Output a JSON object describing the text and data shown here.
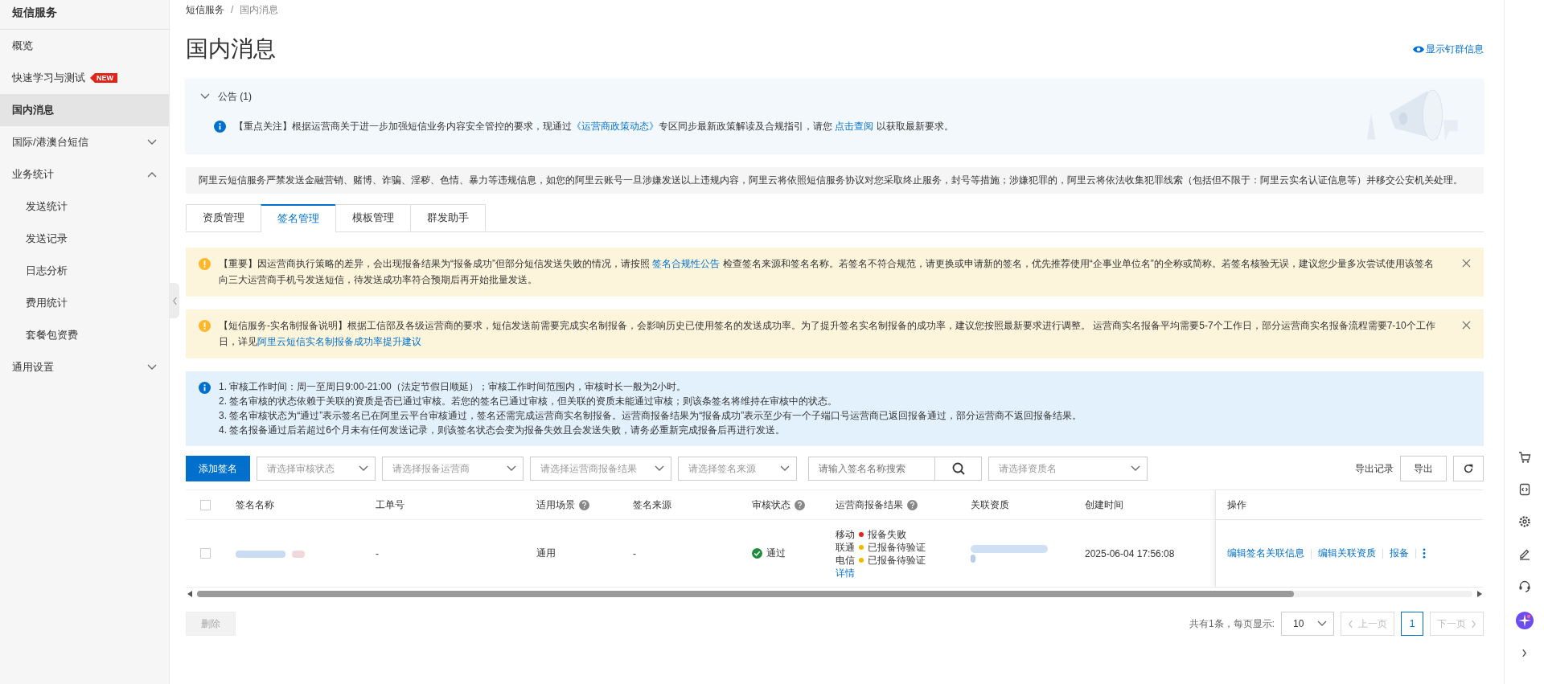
{
  "sidebar": {
    "title": "短信服务",
    "items": [
      {
        "kind": "link",
        "label": "概览",
        "selected": false
      },
      {
        "kind": "link",
        "label": "快速学习与测试",
        "badge": "NEW",
        "selected": false
      },
      {
        "kind": "link",
        "label": "国内消息",
        "selected": true
      },
      {
        "kind": "group",
        "label": "国际/港澳台短信",
        "expanded": false,
        "selected": false
      },
      {
        "kind": "group",
        "label": "业务统计",
        "expanded": true,
        "selected": false,
        "children": [
          {
            "label": "发送统计",
            "selected": false
          },
          {
            "label": "发送记录",
            "selected": false
          },
          {
            "label": "日志分析",
            "selected": false
          },
          {
            "label": "费用统计",
            "selected": false
          },
          {
            "label": "套餐包资费",
            "selected": false
          }
        ]
      },
      {
        "kind": "group",
        "label": "通用设置",
        "expanded": false,
        "selected": false
      }
    ]
  },
  "breadcrumb": {
    "separator": "/",
    "items": [
      "短信服务",
      "国内消息"
    ]
  },
  "page_title": "国内消息",
  "group_info_link": "显示钉群信息",
  "announcement": {
    "title": "公告 (1)",
    "expanded": true,
    "segments": [
      {
        "text": "【重点关注】根据运营商关于进一步加强短信业务内容安全管控的要求，现通过",
        "kind": "text"
      },
      {
        "text": "《运营商政策动态》",
        "kind": "link"
      },
      {
        "text": "专区同步最新政策解读及合规指引，请您 ",
        "kind": "text"
      },
      {
        "text": "点击查阅",
        "kind": "link"
      },
      {
        "text": " 以获取最新要求。",
        "kind": "text"
      }
    ]
  },
  "compliance_notice": "阿里云短信服务严禁发送金融营销、赌博、诈骗、淫秽、色情、暴力等违规信息，如您的阿里云账号一旦涉嫌发送以上违规内容，阿里云将依照短信服务协议对您采取终止服务，封号等措施；涉嫌犯罪的，阿里云将依法收集犯罪线索（包括但不限于：阿里云实名认证信息等）并移交公安机关处理。",
  "tabs": [
    {
      "label": "资质管理",
      "selected": false
    },
    {
      "label": "签名管理",
      "selected": true
    },
    {
      "label": "模板管理",
      "selected": false
    },
    {
      "label": "群发助手",
      "selected": false
    }
  ],
  "notices": [
    {
      "kind": "warning",
      "closable": true,
      "segments": [
        {
          "text": "【重要】因运营商执行策略的差异，会出现报备结果为“报备成功”但部分短信发送失败的情况，请按照 ",
          "kind": "text"
        },
        {
          "text": "签名合规性公告",
          "kind": "link"
        },
        {
          "text": " 检查签名来源和签名名称。若签名不符合规范，请更换或申请新的签名，优先推荐使用“企事业单位名”的全称或简称。若签名核验无误，建议您少量多次尝试使用该签名向三大运营商手机号发送短信，待发送成功率符合预期后再开始批量发送。",
          "kind": "text"
        }
      ]
    },
    {
      "kind": "warning",
      "closable": true,
      "segments": [
        {
          "text": "【短信服务-实名制报备说明】根据工信部及各级运营商的要求，短信发送前需要完成实名制报备，会影响历史已使用签名的发送成功率。为了提升签名实名制报备的成功率，建议您按照最新要求进行调整。 运营商实名报备平均需要5-7个工作日，部分运营商实名报备流程需要7-10个工作日，详见",
          "kind": "text"
        },
        {
          "text": "阿里云短信实名制报备成功率提升建议",
          "kind": "link"
        }
      ]
    },
    {
      "kind": "info",
      "closable": false,
      "lines": [
        "1. 审核工作时间：周一至周日9:00-21:00（法定节假日顺延）；审核工作时间范围内，审核时长一般为2小时。",
        "2. 签名审核的状态依赖于关联的资质是否已通过审核。若您的签名已通过审核，但关联的资质未能通过审核；则该条签名将维持在审核中的状态。",
        "3. 签名审核状态为“通过”表示签名已在阿里云平台审核通过，签名还需完成运营商实名制报备。运营商报备结果为“报备成功”表示至少有一个子端口号运营商已返回报备通过，部分运营商不返回报备结果。",
        "4. 签名报备通过后若超过6个月未有任何发送记录，则该签名状态会变为报备失效且会发送失败，请务必重新完成报备后再进行发送。"
      ]
    }
  ],
  "toolbar": {
    "add_button": "添加签名",
    "filters": [
      {
        "kind": "select",
        "placeholder": "请选择审核状态"
      },
      {
        "kind": "select",
        "placeholder": "请选择报备运营商"
      },
      {
        "kind": "select",
        "placeholder": "请选择运营商报备结果"
      },
      {
        "kind": "select",
        "placeholder": "请选择签名来源"
      },
      {
        "kind": "search",
        "placeholder": "请输入签名名称搜索"
      },
      {
        "kind": "select",
        "placeholder": "请选择资质名"
      }
    ],
    "export_log": "导出记录",
    "export_button": "导出"
  },
  "table": {
    "select_all_checked": false,
    "columns": [
      {
        "label": "签名名称",
        "kind": "plain"
      },
      {
        "label": "工单号",
        "kind": "plain"
      },
      {
        "label": "适用场景",
        "kind": "help"
      },
      {
        "label": "签名来源",
        "kind": "plain"
      },
      {
        "label": "审核状态",
        "kind": "help"
      },
      {
        "label": "运营商报备结果",
        "kind": "help"
      },
      {
        "label": "关联资质",
        "kind": "plain"
      },
      {
        "label": "创建时间",
        "kind": "plain"
      },
      {
        "label": "操作",
        "kind": "plain"
      }
    ],
    "rows": [
      {
        "checked": false,
        "work_order": "-",
        "scene": "通用",
        "source": "-",
        "status": "通过",
        "carriers": [
          {
            "name": "移动",
            "result": "报备失败",
            "color": "#e1251b"
          },
          {
            "name": "联通",
            "result": "已报备待验证",
            "color": "#f5b800"
          },
          {
            "name": "电信",
            "result": "已报备待验证",
            "color": "#f5b800"
          }
        ],
        "detail_link": "详情",
        "created": "2025-06-04 17:56:08",
        "actions": [
          "编辑签名关联信息",
          "编辑关联资质",
          "报备"
        ]
      }
    ]
  },
  "footer": {
    "delete_button": {
      "label": "删除",
      "disabled": true
    },
    "total": "共有1条，每页显示:",
    "page_size": "10",
    "prev": {
      "label": "上一页",
      "disabled": true
    },
    "pages": [
      {
        "label": "1",
        "selected": true
      }
    ],
    "next": {
      "label": "下一页",
      "disabled": true
    }
  }
}
